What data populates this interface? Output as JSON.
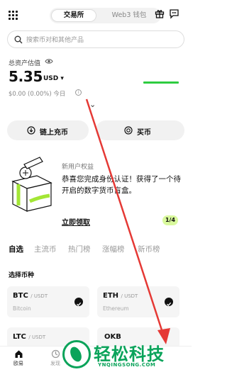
{
  "header": {
    "tabs": [
      {
        "label": "交易所",
        "active": true
      },
      {
        "label": "Web3 钱包",
        "active": false
      }
    ],
    "icons": [
      "grid-menu-icon",
      "gift-icon",
      "chat-icon"
    ]
  },
  "search": {
    "placeholder": "搜索币对和其他产品"
  },
  "assets": {
    "label": "总资产估值",
    "value": "5.35",
    "currency": "USD",
    "pnl": "$0.00 (0.00%) 今日"
  },
  "actions": {
    "deposit_label": "链上充币",
    "buy_label": "买币"
  },
  "promo": {
    "title": "新用户权益",
    "text": "恭喜您完成身份认证！获得了一个待开启的数字货币盲盒。",
    "link": "立即领取",
    "pager": "1/4"
  },
  "market_tabs": [
    {
      "label": "自选",
      "active": true
    },
    {
      "label": "主流币",
      "active": false
    },
    {
      "label": "热门榜",
      "active": false
    },
    {
      "label": "涨幅榜",
      "active": false
    },
    {
      "label": "新币榜",
      "active": false
    }
  ],
  "coin_select": {
    "title": "选择币种",
    "coins": [
      {
        "symbol": "BTC",
        "quote": "/ USDT",
        "name": "Bitcoin"
      },
      {
        "symbol": "ETH",
        "quote": "/ USDT",
        "name": "Ethereum"
      },
      {
        "symbol": "LTC",
        "quote": "/ USDT",
        "name": ""
      },
      {
        "symbol": "OKB",
        "quote": "",
        "name": ""
      }
    ]
  },
  "bottom_nav": [
    {
      "label": "欧易",
      "active": true
    },
    {
      "label": "发现",
      "active": false
    }
  ],
  "watermark": {
    "text": "轻松科技",
    "sub": "YNQINGSONG.COM"
  },
  "colors": {
    "accent_green": "#2ecc40",
    "pager_bg": "#d9f99d",
    "watermark_green": "#0aa35a",
    "arrow_red": "#e53935"
  }
}
